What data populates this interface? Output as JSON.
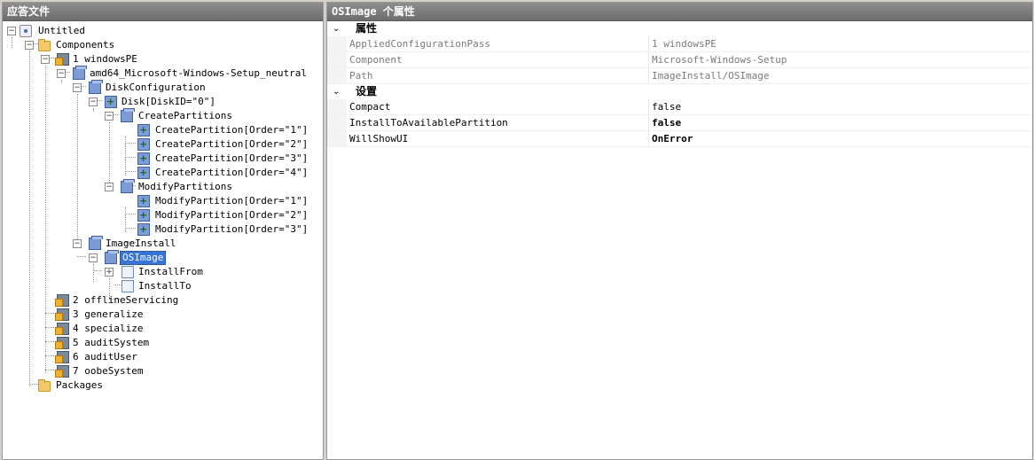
{
  "left_panel": {
    "title": "应答文件"
  },
  "tree": {
    "root": "Untitled",
    "components": "Components",
    "pass1": "1 windowsPE",
    "component": "amd64_Microsoft-Windows-Setup_neutral",
    "disk_configuration": "DiskConfiguration",
    "disk": "Disk[DiskID=\"0\"]",
    "create_partitions": "CreatePartitions",
    "create_partition_items": [
      "CreatePartition[Order=\"1\"]",
      "CreatePartition[Order=\"2\"]",
      "CreatePartition[Order=\"3\"]",
      "CreatePartition[Order=\"4\"]"
    ],
    "modify_partitions": "ModifyPartitions",
    "modify_partition_items": [
      "ModifyPartition[Order=\"1\"]",
      "ModifyPartition[Order=\"2\"]",
      "ModifyPartition[Order=\"3\"]"
    ],
    "image_install": "ImageInstall",
    "os_image": "OSImage",
    "install_from": "InstallFrom",
    "install_to": "InstallTo",
    "passes": [
      "2 offlineServicing",
      "3 generalize",
      "4 specialize",
      "5 auditSystem",
      "6 auditUser",
      "7 oobeSystem"
    ],
    "packages": "Packages"
  },
  "right_panel": {
    "title": "OSImage 个属性"
  },
  "properties": {
    "category_attributes": "属性",
    "attributes": [
      {
        "name": "AppliedConfigurationPass",
        "value": "1 windowsPE"
      },
      {
        "name": "Component",
        "value": "Microsoft-Windows-Setup"
      },
      {
        "name": "Path",
        "value": "ImageInstall/OSImage"
      }
    ],
    "category_settings": "设置",
    "settings": [
      {
        "name": "Compact",
        "value": "false"
      },
      {
        "name": "InstallToAvailablePartition",
        "value": "false"
      },
      {
        "name": "WillShowUI",
        "value": "OnError"
      }
    ]
  },
  "icons": [
    "answer-file-icon",
    "folder-icon",
    "pass-icon",
    "component-icon",
    "setting-add-icon",
    "empty-setting-icon",
    "expand-icon",
    "collapse-icon",
    "chevron-down-icon"
  ],
  "colors": {
    "header_bg": "#7d7d7d",
    "selection": "#3875d7",
    "readonly_text": "#7a7a7a"
  }
}
